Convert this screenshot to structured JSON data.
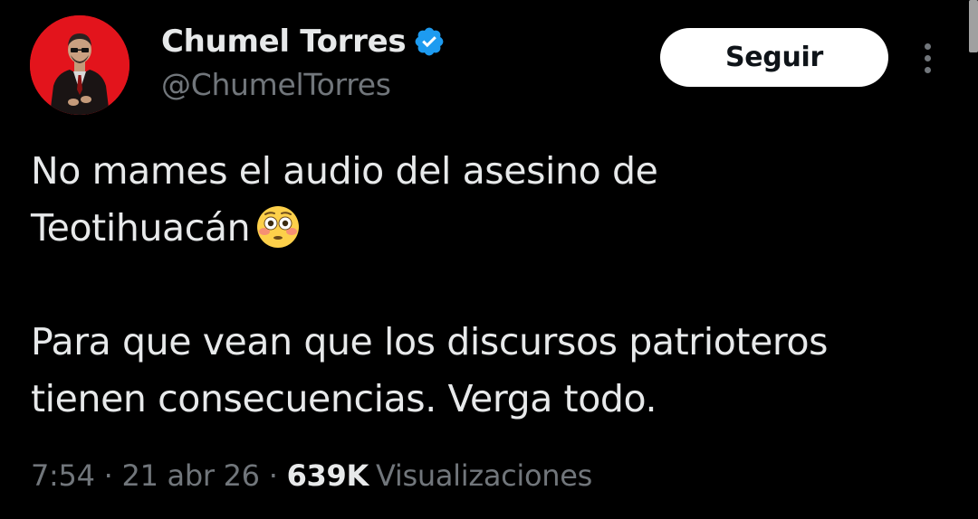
{
  "author": {
    "display_name": "Chumel Torres",
    "handle": "@ChumelTorres",
    "verified_icon": "verified-badge-icon",
    "avatar_icon": "profile-avatar"
  },
  "actions": {
    "follow_label": "Seguir",
    "more_icon": "more-options-icon"
  },
  "tweet": {
    "lines": [
      "No mames el audio del asesino de",
      "Teotihuacán",
      "",
      "Para que vean que los discursos patrioteros",
      "tienen consecuencias. Verga todo."
    ],
    "emoji": "flushed-face-emoji"
  },
  "meta": {
    "time": "7:54",
    "separator": "·",
    "date": "21 abr 26",
    "views_count": "639K",
    "views_label": "Visualizaciones"
  },
  "colors": {
    "background": "#000000",
    "primary_text": "#e7e9ea",
    "secondary_text": "#71767b",
    "verified_blue": "#1d9bf0",
    "avatar_red": "#e3141c",
    "follow_bg": "#ffffff"
  }
}
